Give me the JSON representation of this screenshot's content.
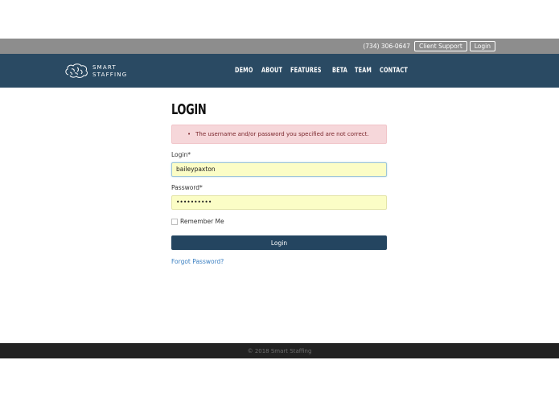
{
  "topbar": {
    "phone": "(734) 306-0647",
    "client_support": "Client Support",
    "login": "Login"
  },
  "logo": {
    "line1": "SMART",
    "line2": "STAFFING"
  },
  "nav": [
    {
      "label": "DEMO"
    },
    {
      "label": "ABOUT"
    },
    {
      "label": "FEATURES"
    },
    {
      "label": "BETA"
    },
    {
      "label": "TEAM"
    },
    {
      "label": "CONTACT"
    }
  ],
  "page": {
    "title": "LOGIN",
    "error": "The username and/or password you specified are not correct.",
    "login_label": "Login*",
    "login_value": "baileypaxton",
    "password_label": "Password*",
    "password_value": "••••••••••",
    "remember_label": "Remember Me",
    "submit_label": "Login",
    "forgot_label": "Forgot Password?"
  },
  "footer": {
    "copyright": "© 2018 Smart Staffing"
  },
  "colors": {
    "navbar": "#2a4a63",
    "topbar": "#8d8d8d",
    "error_bg": "#f6d7da",
    "field_bg": "#fbfdc6",
    "button": "#244560",
    "link": "#3a7fc1",
    "footer": "#222222"
  }
}
